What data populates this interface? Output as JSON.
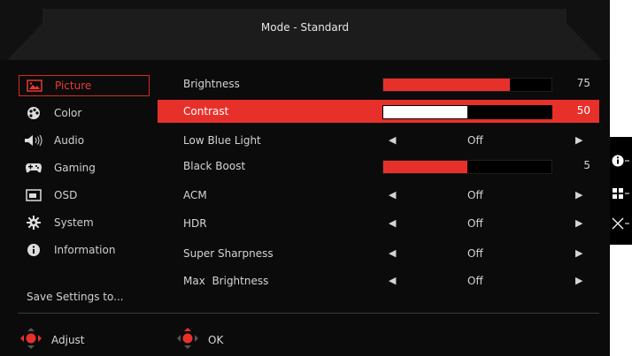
{
  "header": {
    "title": "Mode - Standard"
  },
  "menu": {
    "items": [
      {
        "label": "Picture",
        "icon": "picture-icon",
        "active": true
      },
      {
        "label": "Color",
        "icon": "color-palette-icon"
      },
      {
        "label": "Audio",
        "icon": "speaker-icon"
      },
      {
        "label": "Gaming",
        "icon": "gamepad-icon"
      },
      {
        "label": "OSD",
        "icon": "osd-window-icon"
      },
      {
        "label": "System",
        "icon": "gear-icon"
      },
      {
        "label": "Information",
        "icon": "info-icon"
      }
    ],
    "save_label": "Save Settings to..."
  },
  "settings": [
    {
      "label": "Brightness",
      "type": "slider",
      "value": "75",
      "level": 0.75
    },
    {
      "label": "Contrast",
      "type": "slider",
      "value": "50",
      "level": 0.5,
      "highlighted": true
    },
    {
      "label": "Low Blue Light",
      "type": "select",
      "value": "Off"
    },
    {
      "label": "Black Boost",
      "type": "slider",
      "value": "5",
      "level": 0.5
    },
    {
      "label": "ACM",
      "type": "select",
      "value": "Off"
    },
    {
      "label": "HDR",
      "type": "select",
      "value": "Off"
    },
    {
      "label": "Super Sharpness",
      "type": "select",
      "value": "Off"
    },
    {
      "label": "Max  Brightness",
      "type": "select",
      "value": "Off"
    }
  ],
  "footer": {
    "adjust_label": "Adjust",
    "ok_label": "OK"
  },
  "side_panel": {
    "icons": [
      "info-icon",
      "grid-icon",
      "close-icon"
    ]
  },
  "colors": {
    "accent": "#e8302a",
    "background": "#0b0b0b",
    "text": "#d8d8d8"
  }
}
